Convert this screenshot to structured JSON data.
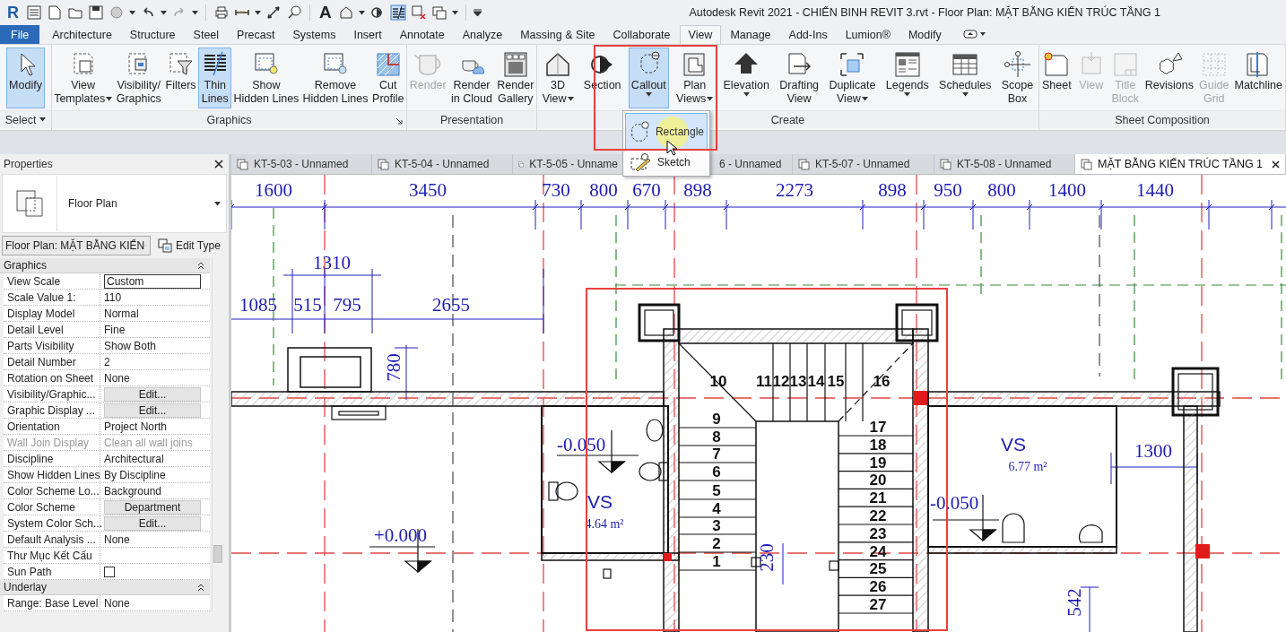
{
  "quick_access_toolbar": {
    "logo": "R",
    "text_tool": "A"
  },
  "title_bar": {
    "title": "Autodesk Revit 2021 - CHIẾN BINH REVIT 3.rvt - Floor Plan: MẶT BẰNG KIẾN TRÚC TẦNG 1"
  },
  "ribbon_tabs": [
    {
      "label": "File",
      "kind": "file",
      "selected": false
    },
    {
      "label": "Architecture",
      "kind": "tab",
      "selected": false
    },
    {
      "label": "Structure",
      "kind": "tab",
      "selected": false
    },
    {
      "label": "Steel",
      "kind": "tab",
      "selected": false
    },
    {
      "label": "Precast",
      "kind": "tab",
      "selected": false
    },
    {
      "label": "Systems",
      "kind": "tab",
      "selected": false
    },
    {
      "label": "Insert",
      "kind": "tab",
      "selected": false
    },
    {
      "label": "Annotate",
      "kind": "tab",
      "selected": false
    },
    {
      "label": "Analyze",
      "kind": "tab",
      "selected": false
    },
    {
      "label": "Massing & Site",
      "kind": "tab",
      "selected": false
    },
    {
      "label": "Collaborate",
      "kind": "tab",
      "selected": false
    },
    {
      "label": "View",
      "kind": "tab",
      "selected": true
    },
    {
      "label": "Manage",
      "kind": "tab",
      "selected": false
    },
    {
      "label": "Add-Ins",
      "kind": "tab",
      "selected": false
    },
    {
      "label": "Lumion®",
      "kind": "tab",
      "selected": false
    },
    {
      "label": "Modify",
      "kind": "tab",
      "selected": false
    }
  ],
  "ribbon_panels": [
    {
      "title": "Select",
      "menu": true,
      "launcher": false,
      "tools": [
        {
          "lines": [
            "Modify"
          ],
          "dropdown": false,
          "selected": true,
          "disabled": false
        }
      ]
    },
    {
      "title": "Graphics",
      "menu": false,
      "launcher": true,
      "tools": [
        {
          "lines": [
            "View",
            "Templates"
          ],
          "dropdown": true,
          "selected": false,
          "disabled": false
        },
        {
          "lines": [
            "Visibility/",
            "Graphics"
          ],
          "dropdown": false,
          "selected": false,
          "disabled": false
        },
        {
          "lines": [
            "Filters"
          ],
          "dropdown": false,
          "selected": false,
          "disabled": false
        },
        {
          "lines": [
            "Thin",
            "Lines"
          ],
          "dropdown": false,
          "selected": true,
          "disabled": false
        },
        {
          "lines": [
            "Show",
            "Hidden Lines"
          ],
          "dropdown": false,
          "selected": false,
          "disabled": false
        },
        {
          "lines": [
            "Remove",
            "Hidden Lines"
          ],
          "dropdown": false,
          "selected": false,
          "disabled": false
        },
        {
          "lines": [
            "Cut",
            "Profile"
          ],
          "dropdown": false,
          "selected": false,
          "disabled": false
        }
      ]
    },
    {
      "title": "Presentation",
      "menu": false,
      "launcher": false,
      "tools": [
        {
          "lines": [
            "Render"
          ],
          "dropdown": false,
          "selected": false,
          "disabled": true
        },
        {
          "lines": [
            "Render",
            "in Cloud"
          ],
          "dropdown": false,
          "selected": false,
          "disabled": false
        },
        {
          "lines": [
            "Render",
            "Gallery"
          ],
          "dropdown": false,
          "selected": false,
          "disabled": false
        }
      ]
    },
    {
      "title": "Create",
      "menu": false,
      "launcher": false,
      "tools": [
        {
          "lines": [
            "3D",
            "View"
          ],
          "dropdown": true,
          "selected": false,
          "disabled": false
        },
        {
          "lines": [
            "Section"
          ],
          "dropdown": false,
          "selected": false,
          "disabled": false
        },
        {
          "lines": [
            "Callout"
          ],
          "dropdown": true,
          "selected": true,
          "disabled": false
        },
        {
          "lines": [
            "Plan",
            "Views"
          ],
          "dropdown": true,
          "selected": false,
          "disabled": false
        },
        {
          "lines": [
            "Elevation"
          ],
          "dropdown": true,
          "selected": false,
          "disabled": false
        },
        {
          "lines": [
            "Drafting",
            "View"
          ],
          "dropdown": false,
          "selected": false,
          "disabled": false
        },
        {
          "lines": [
            "Duplicate",
            "View"
          ],
          "dropdown": true,
          "selected": false,
          "disabled": false
        },
        {
          "lines": [
            "Legends"
          ],
          "dropdown": true,
          "selected": false,
          "disabled": false
        },
        {
          "lines": [
            "Schedules"
          ],
          "dropdown": true,
          "selected": false,
          "disabled": false
        },
        {
          "lines": [
            "Scope",
            "Box"
          ],
          "dropdown": false,
          "selected": false,
          "disabled": false
        }
      ]
    },
    {
      "title": "Sheet Composition",
      "menu": false,
      "launcher": false,
      "tools": [
        {
          "lines": [
            "Sheet"
          ],
          "dropdown": false,
          "selected": false,
          "disabled": false
        },
        {
          "lines": [
            "View"
          ],
          "dropdown": false,
          "selected": false,
          "disabled": true
        },
        {
          "lines": [
            "Title",
            "Block"
          ],
          "dropdown": false,
          "selected": false,
          "disabled": true
        },
        {
          "lines": [
            "Revisions"
          ],
          "dropdown": false,
          "selected": false,
          "disabled": false
        },
        {
          "lines": [
            "Guide",
            "Grid"
          ],
          "dropdown": false,
          "selected": false,
          "disabled": true
        },
        {
          "lines": [
            "Matchline"
          ],
          "dropdown": false,
          "selected": false,
          "disabled": false
        }
      ]
    }
  ],
  "callout_menu": [
    {
      "label": "Rectangle",
      "selected": true
    },
    {
      "label": "Sketch",
      "selected": false
    }
  ],
  "properties": {
    "title": "Properties",
    "type_name": "Floor Plan",
    "instance": "Floor Plan: MẶT BẰNG KIẾN",
    "edit_type": "Edit Type",
    "groups": [
      {
        "title": "Graphics",
        "expanded": true,
        "rows": [
          {
            "name": "View Scale",
            "value": "Custom",
            "kind": "field",
            "disabled": false
          },
          {
            "name": "Scale Value    1:",
            "value": "110",
            "kind": "text",
            "disabled": false
          },
          {
            "name": "Display Model",
            "value": "Normal",
            "kind": "text",
            "disabled": false
          },
          {
            "name": "Detail Level",
            "value": "Fine",
            "kind": "text",
            "disabled": false
          },
          {
            "name": "Parts Visibility",
            "value": "Show Both",
            "kind": "text",
            "disabled": false
          },
          {
            "name": "Detail Number",
            "value": "2",
            "kind": "text",
            "disabled": false
          },
          {
            "name": "Rotation on Sheet",
            "value": "None",
            "kind": "text",
            "disabled": false
          },
          {
            "name": "Visibility/Graphic...",
            "value": "Edit...",
            "kind": "button",
            "disabled": false
          },
          {
            "name": "Graphic Display ...",
            "value": "Edit...",
            "kind": "button",
            "disabled": false
          },
          {
            "name": "Orientation",
            "value": "Project North",
            "kind": "text",
            "disabled": false
          },
          {
            "name": "Wall Join Display",
            "value": "Clean all wall joins",
            "kind": "text",
            "disabled": true
          },
          {
            "name": "Discipline",
            "value": "Architectural",
            "kind": "text",
            "disabled": false
          },
          {
            "name": "Show Hidden Lines",
            "value": "By Discipline",
            "kind": "text",
            "disabled": false
          },
          {
            "name": "Color Scheme Lo...",
            "value": "Background",
            "kind": "text",
            "disabled": false
          },
          {
            "name": "Color Scheme",
            "value": "Department",
            "kind": "button",
            "disabled": false
          },
          {
            "name": "System Color Sch...",
            "value": "Edit...",
            "kind": "button",
            "disabled": false
          },
          {
            "name": "Default Analysis ...",
            "value": "None",
            "kind": "text",
            "disabled": false
          },
          {
            "name": "Thư Mục Kết Cấu",
            "kind": "text",
            "disabled": false
          },
          {
            "name": "Sun Path",
            "kind": "checkbox",
            "checked": false,
            "disabled": false
          }
        ]
      },
      {
        "title": "Underlay",
        "expanded": true,
        "rows": [
          {
            "name": "Range: Base Level",
            "value": "None",
            "kind": "text",
            "disabled": false
          }
        ]
      }
    ]
  },
  "view_tabs": [
    {
      "label": "KT-5-03 - Unnamed",
      "icon": true,
      "selected": false
    },
    {
      "label": "KT-5-04 - Unnamed",
      "icon": true,
      "selected": false
    },
    {
      "label": "KT-5-05 - Unname",
      "icon": true,
      "selected": false
    },
    {
      "label": "6 - Unnamed",
      "icon": false,
      "selected": false
    },
    {
      "label": "KT-5-07 - Unnamed",
      "icon": true,
      "selected": false
    },
    {
      "label": "KT-5-08 - Unnamed",
      "icon": true,
      "selected": false
    },
    {
      "label": "MẶT BẰNG KIẾN TRÚC TẦNG 1",
      "icon": true,
      "selected": true
    }
  ],
  "plan": {
    "labels": [
      {
        "kind": "dimension",
        "text": "1600"
      },
      {
        "kind": "dimension",
        "text": "3450"
      },
      {
        "kind": "dimension",
        "text": "730"
      },
      {
        "kind": "dimension",
        "text": "800"
      },
      {
        "kind": "dimension",
        "text": "670"
      },
      {
        "kind": "dimension",
        "text": "898"
      },
      {
        "kind": "dimension",
        "text": "2273"
      },
      {
        "kind": "dimension",
        "text": "898"
      },
      {
        "kind": "dimension",
        "text": "950"
      },
      {
        "kind": "dimension",
        "text": "800"
      },
      {
        "kind": "dimension",
        "text": "1400"
      },
      {
        "kind": "dimension",
        "text": "1440"
      },
      {
        "kind": "dimension",
        "text": "1310"
      },
      {
        "kind": "dimension",
        "text": "1085"
      },
      {
        "kind": "dimension",
        "text": "515"
      },
      {
        "kind": "dimension",
        "text": "795"
      },
      {
        "kind": "dimension",
        "text": "2655"
      },
      {
        "kind": "dimension",
        "text": "780"
      },
      {
        "kind": "dimension",
        "text": "1300"
      },
      {
        "kind": "dimension",
        "text": "230"
      },
      {
        "kind": "dimension",
        "text": "542"
      },
      {
        "kind": "level",
        "text": "-0.050"
      },
      {
        "kind": "level",
        "text": "-0.050"
      },
      {
        "kind": "level",
        "text": "+0.000"
      },
      {
        "kind": "room",
        "text": "VS"
      },
      {
        "kind": "area",
        "text": "4.64 m²"
      },
      {
        "kind": "room",
        "text": "VS"
      },
      {
        "kind": "area",
        "text": "6.77 m²"
      },
      {
        "kind": "step",
        "text": "10"
      },
      {
        "kind": "step",
        "text": "11"
      },
      {
        "kind": "step",
        "text": "12"
      },
      {
        "kind": "step",
        "text": "13"
      },
      {
        "kind": "step",
        "text": "14"
      },
      {
        "kind": "step",
        "text": "15"
      },
      {
        "kind": "step",
        "text": "16"
      },
      {
        "kind": "step",
        "text": "9"
      },
      {
        "kind": "step",
        "text": "17"
      },
      {
        "kind": "step",
        "text": "8"
      },
      {
        "kind": "step",
        "text": "18"
      },
      {
        "kind": "step",
        "text": "7"
      },
      {
        "kind": "step",
        "text": "19"
      },
      {
        "kind": "step",
        "text": "6"
      },
      {
        "kind": "step",
        "text": "20"
      },
      {
        "kind": "step",
        "text": "5"
      },
      {
        "kind": "step",
        "text": "21"
      },
      {
        "kind": "step",
        "text": "4"
      },
      {
        "kind": "step",
        "text": "22"
      },
      {
        "kind": "step",
        "text": "3"
      },
      {
        "kind": "step",
        "text": "23"
      },
      {
        "kind": "step",
        "text": "2"
      },
      {
        "kind": "step",
        "text": "24"
      },
      {
        "kind": "step",
        "text": "1"
      },
      {
        "kind": "step",
        "text": "25"
      },
      {
        "kind": "step",
        "text": "26"
      },
      {
        "kind": "step",
        "text": "27"
      }
    ]
  }
}
